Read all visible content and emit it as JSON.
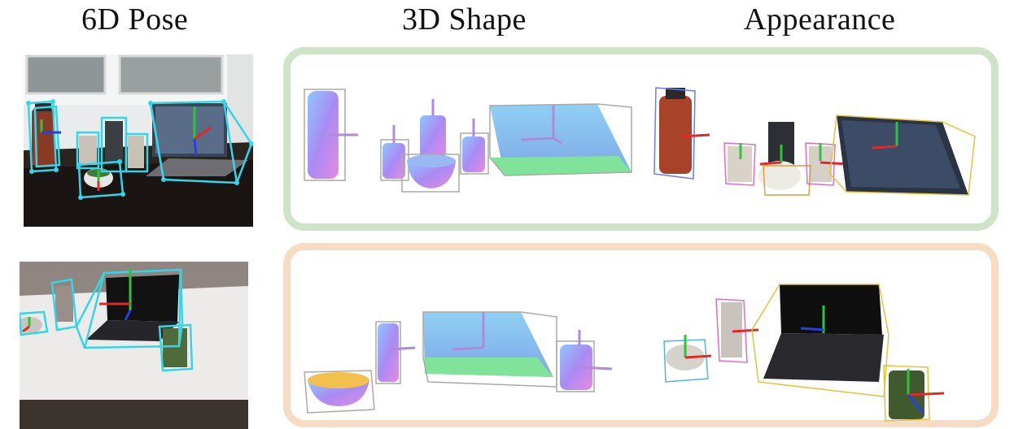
{
  "headers": {
    "pose": "6D Pose",
    "shape": "3D Shape",
    "appearance": "Appearance"
  },
  "colors": {
    "panel_top_border": "#cfe3c7",
    "panel_bottom_border": "#f7dcc4",
    "pose_box": "#33d6e8",
    "axis_x": "#e02a2a",
    "axis_y": "#2fc23a",
    "axis_z": "#2a3fe0",
    "shape_bbox": "#a9a9a9"
  },
  "rows": [
    {
      "name": "tabletop-scene",
      "objects": [
        "bottle",
        "can",
        "can",
        "mug",
        "can",
        "laptop"
      ]
    },
    {
      "name": "white-table-scene",
      "objects": [
        "bowl",
        "can",
        "laptop",
        "can"
      ]
    }
  ]
}
